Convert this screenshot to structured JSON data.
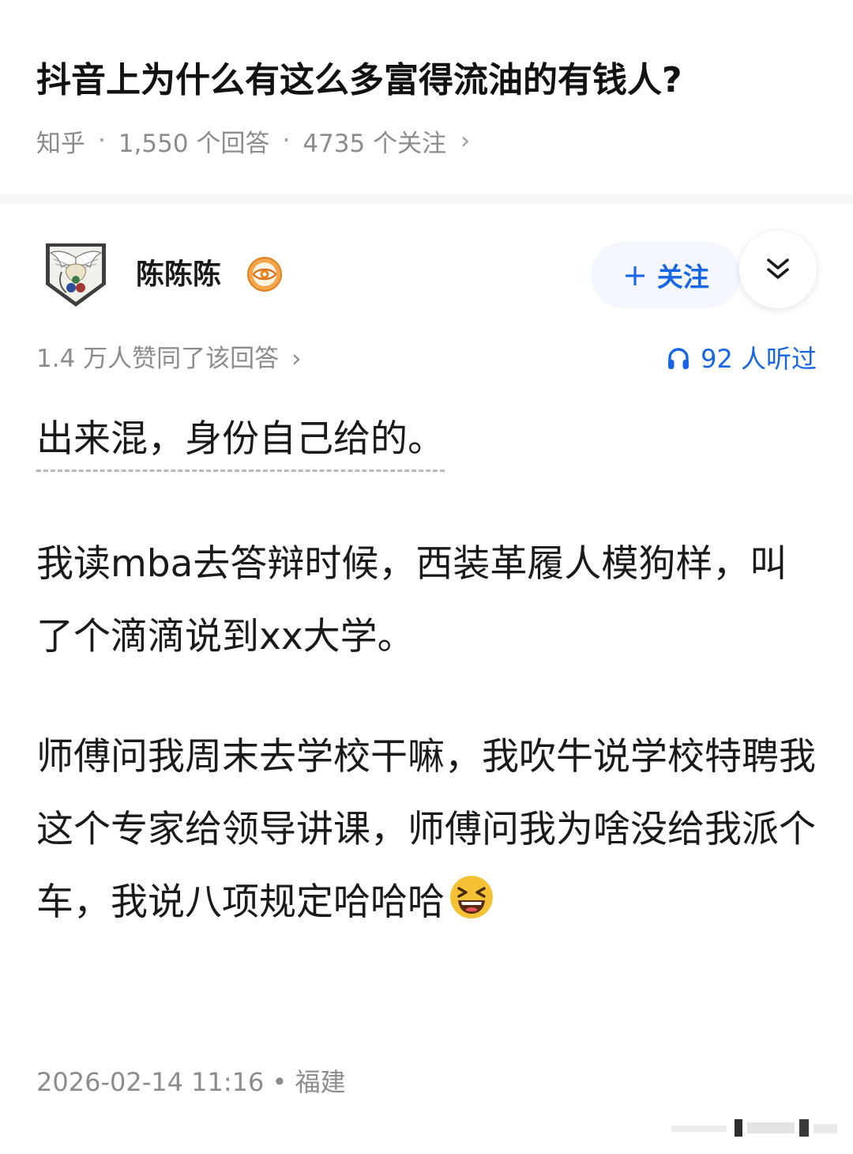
{
  "question": {
    "title": "抖音上为什么有这么多富得流油的有钱人?",
    "source": "知乎",
    "answers": "1,550 个回答",
    "follows": "4735 个关注",
    "separator": "·",
    "chevron": "›"
  },
  "author": {
    "name": "陈陈陈",
    "avatar_icon": "wings-emblem-avatar",
    "badge_icon": "eye-badge-icon",
    "follow_label": "关注",
    "follow_plus": "+",
    "collapse_icon": "double-chevron-down-icon"
  },
  "stats": {
    "approvals": "1.4 万人赞同了该回答",
    "listened": "92 人听过",
    "listen_icon": "headphones-icon"
  },
  "answer": {
    "lead": "出来混，身份自己给的。",
    "paragraph1": "我读mba去答辩时候，西装革履人模狗样，叫了个滴滴说到xx大学。",
    "paragraph2": "师傅问我周末去学校干嘛，我吹牛说学校特聘我这个专家给领导讲课，师傅问我为啥没给我派个车，我说八项规定哈哈哈",
    "emoji": "laughing-emoji"
  },
  "footer": {
    "timestamp": "2026-02-14 11:16 • 福建"
  },
  "colors": {
    "accent": "#1766e6",
    "muted": "#8c8c8c",
    "text": "#1a1a1a"
  }
}
